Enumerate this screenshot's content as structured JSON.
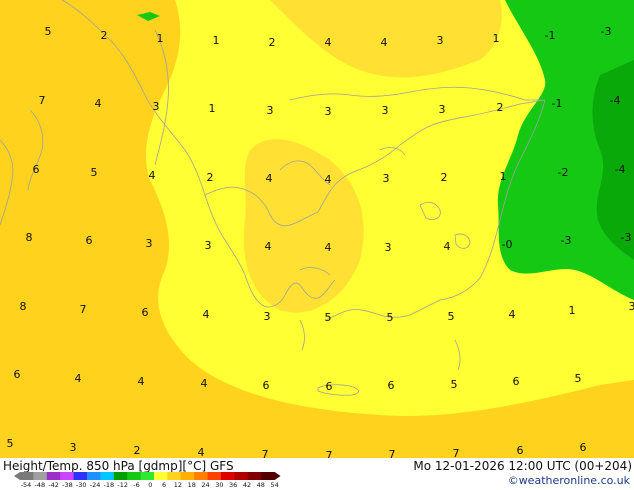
{
  "map": {
    "colors": {
      "sea": "#ffff33",
      "land_warm": "#ffd21e",
      "land_mid": "#ffe033",
      "cold_green": "#14c814",
      "cold_green_dark": "#0aa90a",
      "outline": "#a0a0a0"
    },
    "values": [
      "5",
      "2",
      "1",
      "1",
      "2",
      "4",
      "4",
      "3",
      "1",
      "-1",
      "-3",
      "7",
      "4",
      "3",
      "1",
      "3",
      "3",
      "3",
      "3",
      "2",
      "-1",
      "-4",
      "6",
      "5",
      "4",
      "2",
      "4",
      "4",
      "3",
      "2",
      "1",
      "-2",
      "-4",
      "8",
      "6",
      "3",
      "3",
      "4",
      "4",
      "3",
      "4",
      "-0",
      "-3",
      "-3",
      "8",
      "7",
      "6",
      "4",
      "3",
      "5",
      "5",
      "5",
      "4",
      "1",
      "3",
      "6",
      "4",
      "4",
      "4",
      "6",
      "6",
      "6",
      "5",
      "6",
      "5",
      "5",
      "3",
      "2",
      "4",
      "7",
      "7",
      "7",
      "7",
      "6",
      "6"
    ]
  },
  "footer": {
    "title": "Height/Temp. 850 hPa [gdmp][°C] GFS",
    "datetime": "Mo 12-01-2026 12:00 UTC (00+204)",
    "credit": "©weatheronline.co.uk"
  },
  "legend": {
    "labels": [
      "-54",
      "-48",
      "-42",
      "-38",
      "-30",
      "-24",
      "-18",
      "-12",
      "-6",
      "0",
      "6",
      "12",
      "18",
      "24",
      "30",
      "36",
      "42",
      "48",
      "54"
    ],
    "colors": [
      "#7a7a7a",
      "#a0a0a0",
      "#9a30c8",
      "#cc44ff",
      "#3030ff",
      "#2090ff",
      "#00c8ff",
      "#00a000",
      "#14c814",
      "#30e830",
      "#ffff33",
      "#ffd21e",
      "#ffb000",
      "#ff8000",
      "#ff4000",
      "#e00000",
      "#b00000",
      "#800000",
      "#500000"
    ]
  }
}
